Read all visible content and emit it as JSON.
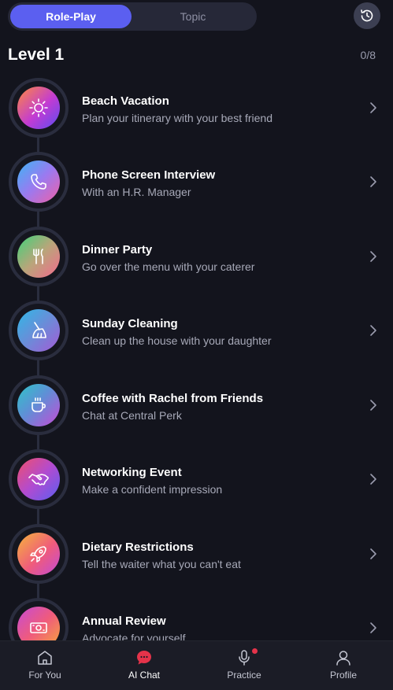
{
  "tabs": {
    "roleplay": "Role-Play",
    "topic": "Topic"
  },
  "level": {
    "title": "Level 1",
    "progress": "0/8"
  },
  "lessons": [
    {
      "title": "Beach Vacation",
      "subtitle": "Plan your itinerary with your best friend",
      "icon": "sun-icon"
    },
    {
      "title": "Phone Screen Interview",
      "subtitle": "With an H.R. Manager",
      "icon": "phone-icon"
    },
    {
      "title": "Dinner Party",
      "subtitle": "Go over the menu with your caterer",
      "icon": "fork-knife-icon"
    },
    {
      "title": "Sunday Cleaning",
      "subtitle": "Clean up the house with your daughter",
      "icon": "broom-icon"
    },
    {
      "title": "Coffee with Rachel from Friends",
      "subtitle": "Chat at Central Perk",
      "icon": "coffee-cup-icon"
    },
    {
      "title": "Networking Event",
      "subtitle": "Make a confident impression",
      "icon": "handshake-icon"
    },
    {
      "title": "Dietary Restrictions",
      "subtitle": "Tell the waiter what you can't eat",
      "icon": "rocket-icon"
    },
    {
      "title": "Annual Review",
      "subtitle": "Advocate for yourself",
      "icon": "money-icon"
    }
  ],
  "nav": {
    "for_you": "For You",
    "ai_chat": "AI Chat",
    "practice": "Practice",
    "profile": "Profile"
  },
  "colors": {
    "accent": "#5b5ff0",
    "badge": "#e5334a",
    "chat_active": "#e5334a"
  }
}
